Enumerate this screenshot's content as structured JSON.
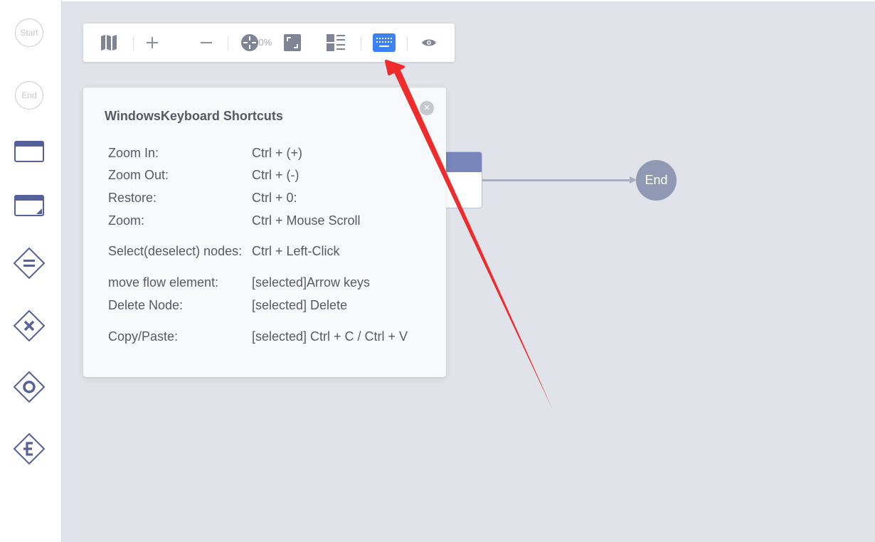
{
  "palette": {
    "items": [
      {
        "label": "Start",
        "icon": "start-event-icon"
      },
      {
        "label": "End",
        "icon": "end-event-icon"
      },
      {
        "icon": "user-task-icon"
      },
      {
        "icon": "subprocess-icon"
      },
      {
        "icon": "exclusive-gateway-icon"
      },
      {
        "icon": "parallel-gateway-icon"
      },
      {
        "icon": "inclusive-gateway-icon"
      },
      {
        "icon": "event-gateway-icon"
      }
    ]
  },
  "toolbar": {
    "zoom_level": "100%",
    "active_button": "keyboard-shortcuts",
    "accent_color": "#3b82f6"
  },
  "canvas": {
    "end_node_label": "End"
  },
  "shortcuts_popup": {
    "title": "WindowsKeyboard Shortcuts",
    "close_glyph": "×",
    "rows": [
      {
        "action": "Zoom In:",
        "keys": "Ctrl + (+)"
      },
      {
        "action": "Zoom Out:",
        "keys": "Ctrl + (-)"
      },
      {
        "action": "Restore:",
        "keys": "Ctrl + 0:"
      },
      {
        "action": "Zoom:",
        "keys": "Ctrl + Mouse Scroll"
      },
      {
        "action": "Select(deselect) nodes:",
        "keys": "Ctrl + Left-Click"
      },
      {
        "action": "move flow element:",
        "keys": "[selected]Arrow keys"
      },
      {
        "action": "Delete Node:",
        "keys": "[selected] Delete"
      },
      {
        "action": "Copy/Paste:",
        "keys": "[selected] Ctrl + C / Ctrl + V"
      }
    ]
  },
  "annotation": {
    "arrow_color": "#ef2b2b"
  }
}
